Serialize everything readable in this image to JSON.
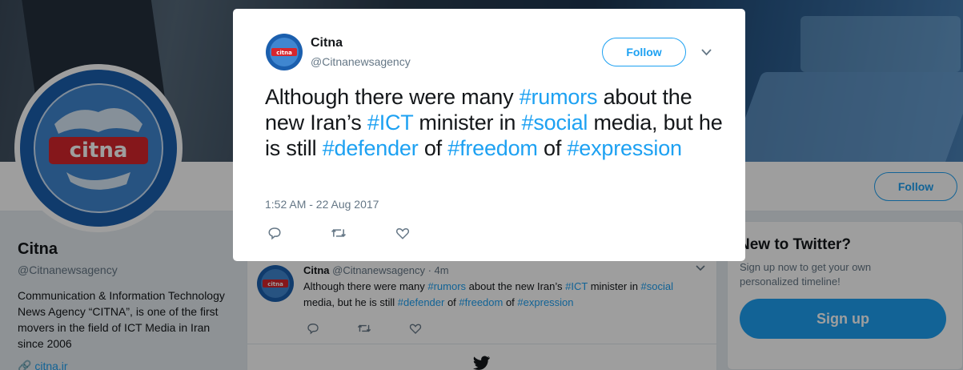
{
  "background_profile": {
    "name": "Citna",
    "handle": "@Citnanewsagency",
    "bio": "Communication & Information Technology News Agency “CITNA”, is one of the first movers in the field of ICT Media in Iran since 2006",
    "link": "citna.ir",
    "follow_label": "Follow",
    "logo_text": "citna"
  },
  "timeline_tweet": {
    "name": "Citna",
    "handle": "@Citnanewsagency",
    "time": "· 4m",
    "text_parts": [
      {
        "t": "Although there were many ",
        "tag": false
      },
      {
        "t": "#rumors",
        "tag": true
      },
      {
        "t": " about the new Iran’s ",
        "tag": false
      },
      {
        "t": "#ICT",
        "tag": true
      },
      {
        "t": " minister in ",
        "tag": false
      },
      {
        "t": "#social",
        "tag": true
      },
      {
        "t": " media, but he is still ",
        "tag": false
      },
      {
        "t": "#defender",
        "tag": true
      },
      {
        "t": " of ",
        "tag": false
      },
      {
        "t": "#freedom",
        "tag": true
      },
      {
        "t": " of ",
        "tag": false
      },
      {
        "t": "#expression",
        "tag": true
      }
    ]
  },
  "side_card": {
    "title": "New to Twitter?",
    "subtitle": "Sign up now to get your own personalized timeline!",
    "signup_label": "Sign up"
  },
  "modal": {
    "name": "Citna",
    "handle": "@Citnanewsagency",
    "follow_label": "Follow",
    "timestamp": "1:52 AM - 22 Aug 2017"
  },
  "icons": [
    "reply-icon",
    "retweet-icon",
    "like-icon",
    "chevron-down-icon",
    "twitter-bird-icon"
  ],
  "colors": {
    "accent": "#1da1f2",
    "text": "#14171a",
    "muted": "#657786",
    "logo_red": "#d7262d",
    "logo_blue": "#1b5fae"
  }
}
